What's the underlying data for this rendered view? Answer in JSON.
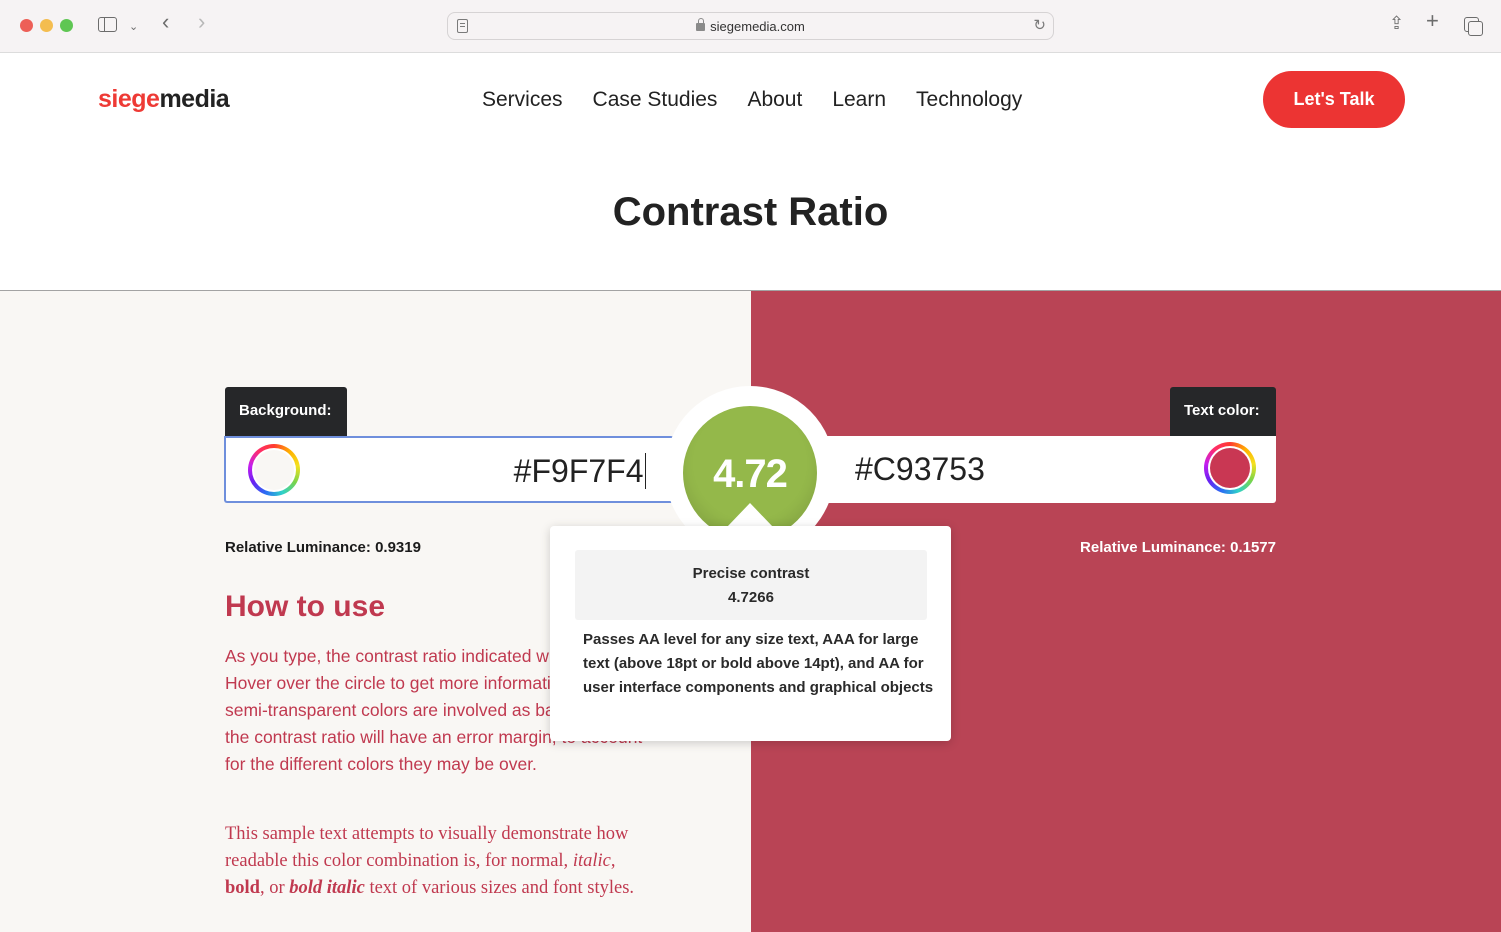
{
  "browser": {
    "url": "siegemedia.com",
    "icons": [
      "sidebar-icon",
      "chevron-down-icon",
      "back-icon",
      "forward-icon",
      "reader-icon",
      "lock-icon",
      "reload-icon",
      "share-icon",
      "new-tab-icon",
      "tabs-overview-icon"
    ]
  },
  "header": {
    "logo_part1": "siege",
    "logo_part2": "media",
    "nav": [
      "Services",
      "Case Studies",
      "About",
      "Learn",
      "Technology"
    ],
    "cta": "Let's Talk"
  },
  "page": {
    "title": "Contrast Ratio"
  },
  "background": {
    "label": "Background:",
    "value": "#F9F7F4",
    "luminance_label": "Relative Luminance:",
    "luminance_value": "0.9319"
  },
  "text_color": {
    "label": "Text color:",
    "value": "#C93753",
    "luminance_label": "Relative Luminance:",
    "luminance_value": "0.1577"
  },
  "ratio": {
    "value": "4.72",
    "color": "#94B84A"
  },
  "tooltip": {
    "title": "Precise contrast",
    "value": "4.7266",
    "description": "Passes AA level for any size text, AAA for large text (above 18pt or bold above 14pt), and AA for user interface components and graphical objects"
  },
  "how_to": {
    "title": "How to use",
    "body": "As you type, the contrast ratio indicated will update. Hover over the circle to get more information. When semi-transparent colors are involved as backgrounds, the contrast ratio will have an error margin, to account for the different colors they may be over.",
    "sample_parts": {
      "p1": "This sample text attempts to visually demonstrate how readable this color combination is, for normal, ",
      "italic": "italic",
      "sep1": ", ",
      "bold": "bold",
      "sep2": ", or ",
      "bold_italic": "bold italic",
      "p2": " text of various sizes and font styles."
    }
  }
}
